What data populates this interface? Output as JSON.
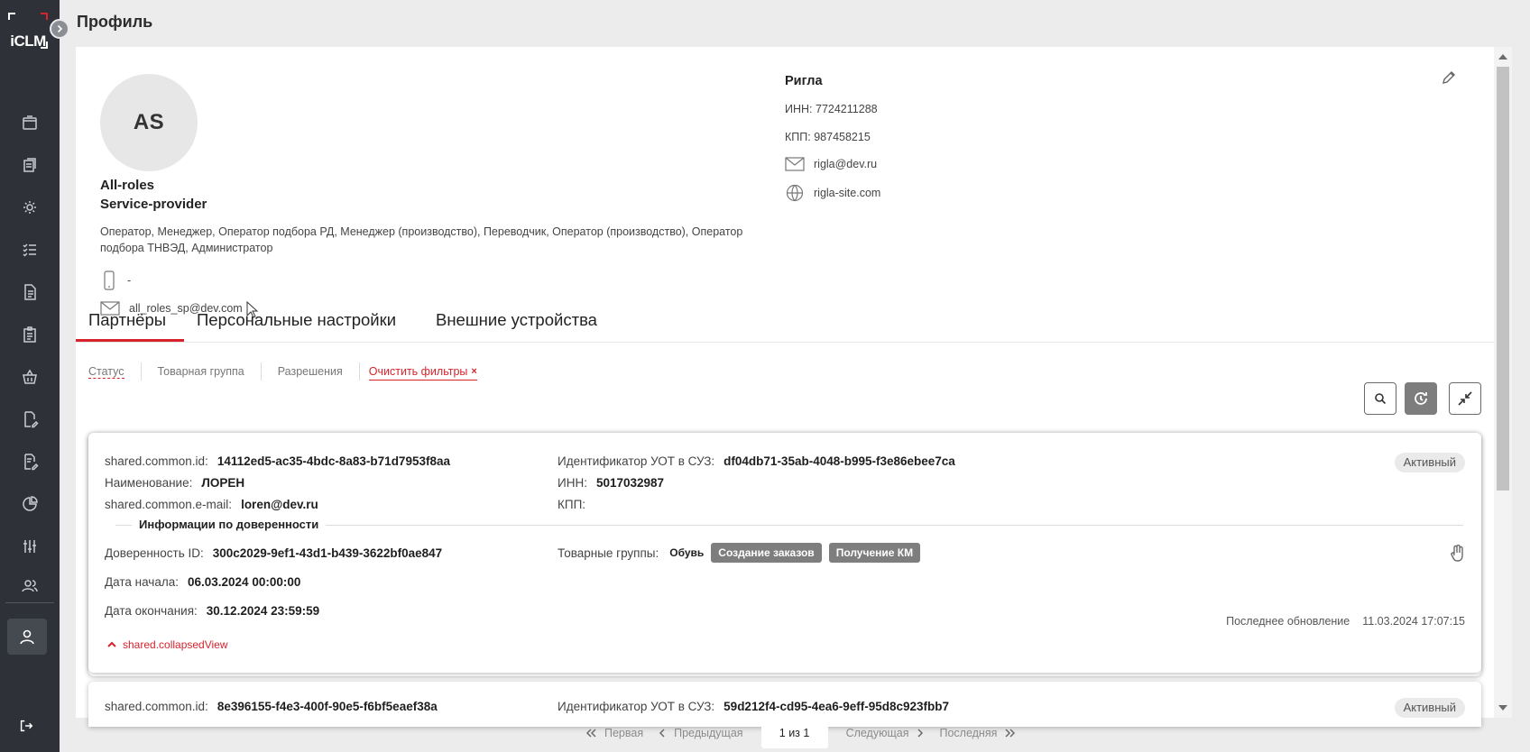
{
  "app": {
    "logo_text": "iCLM",
    "page_title": "Профиль"
  },
  "sidebar": {
    "items": [
      {
        "icon": "box-icon"
      },
      {
        "icon": "documents-icon"
      },
      {
        "icon": "settings-gear-icon"
      },
      {
        "icon": "checklist-icon"
      },
      {
        "icon": "document-icon"
      },
      {
        "icon": "clipboard-icon"
      },
      {
        "icon": "basket-icon"
      },
      {
        "icon": "doc-edit-icon"
      },
      {
        "icon": "doc-edit2-icon"
      },
      {
        "icon": "pie-chart-icon"
      },
      {
        "icon": "sliders-icon"
      },
      {
        "icon": "users-icon"
      }
    ],
    "active_icon": "user-icon",
    "logout_icon": "logout-icon"
  },
  "profile": {
    "initials": "AS",
    "name_line1": "All-roles",
    "name_line2": "Service-provider",
    "roles": "Оператор, Менеджер, Оператор подбора РД, Менеджер (производство), Переводчик, Оператор (производство), Оператор подбора ТНВЭД, Администратор",
    "phone": "-",
    "email": "all_roles_sp@dev.com"
  },
  "organization": {
    "name": "Ригла",
    "inn_label": "ИНН:",
    "inn": "7724211288",
    "kpp_label": "КПП:",
    "kpp": "987458215",
    "email": "rigla@dev.ru",
    "site": "rigla-site.com"
  },
  "tabs": [
    {
      "label": "Партнёры",
      "active": true
    },
    {
      "label": "Персональные настройки",
      "active": false
    },
    {
      "label": "Внешние устройства",
      "active": false
    }
  ],
  "filters": {
    "status": "Статус",
    "product_group": "Товарная группа",
    "permissions": "Разрешения",
    "clear": "Очистить фильтры",
    "clear_mark": "×"
  },
  "partners": [
    {
      "id_label": "shared.common.id:",
      "id": "14112ed5-ac35-4bdc-8a83-b71d7953f8aa",
      "name_label": "Наименование:",
      "name": "ЛОРЕН",
      "email_label": "shared.common.e-mail:",
      "email": "loren@dev.ru",
      "uot_label": "Идентификатор УОТ в СУЗ:",
      "uot": "df04db71-35ab-4048-b995-f3e86ebee7ca",
      "inn_label": "ИНН:",
      "inn": "5017032987",
      "kpp_label": "КПП:",
      "kpp": "",
      "status": "Активный",
      "section_title": "Информации по доверенности",
      "poa_id_label": "Доверенность ID:",
      "poa_id": "300c2029-9ef1-43d1-b439-3622bf0ae847",
      "start_label": "Дата начала:",
      "start": "06.03.2024 00:00:00",
      "end_label": "Дата окончания:",
      "end": "30.12.2024 23:59:59",
      "groups_label": "Товарные группы:",
      "group": "Обувь",
      "tags": [
        "Создание заказов",
        "Получение КМ"
      ],
      "collapse_link": "shared.collapsedView",
      "last_update_label": "Последнее обновление",
      "last_update": "11.03.2024 17:07:15"
    },
    {
      "id_label": "shared.common.id:",
      "id": "8e396155-f4e3-400f-90e5-f6bf5eaef38a",
      "uot_label": "Идентификатор УОТ в СУЗ:",
      "uot": "59d212f4-cd95-4ea6-9eff-95d8c923fbb7",
      "status": "Активный"
    }
  ],
  "pagination": {
    "first": "Первая",
    "prev": "Предыдущая",
    "current": "1 из 1",
    "next": "Следующая",
    "last": "Последняя"
  }
}
